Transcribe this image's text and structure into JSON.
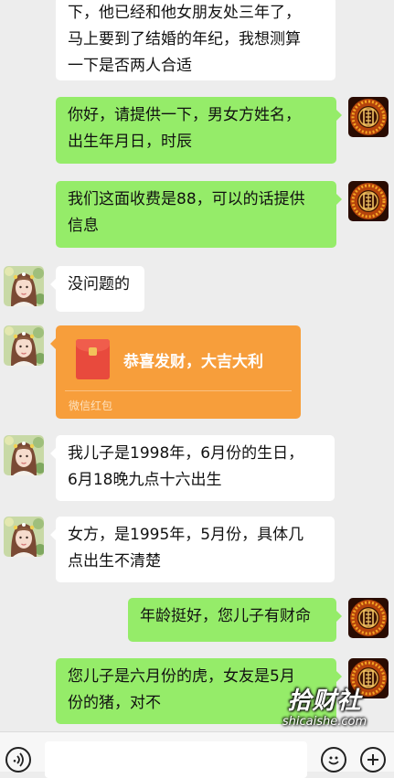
{
  "messages": [
    {
      "side": "in",
      "lines": [
        "下，他已经和他女朋友处三年了，",
        "马上要到了结婚的年纪，我想测算",
        "一下是否两人合适"
      ]
    },
    {
      "side": "out",
      "lines": [
        "你好，请提供一下，男女方姓名，",
        "出生年月日，时辰"
      ]
    },
    {
      "side": "out",
      "lines": [
        "我们这面收费是88，可以的话提供",
        "信息"
      ]
    },
    {
      "side": "in",
      "lines": [
        "没问题的"
      ]
    },
    {
      "side": "in",
      "type": "red-packet",
      "title": "恭喜发财，大吉大利",
      "footer": "微信红包"
    },
    {
      "side": "in",
      "lines": [
        "我儿子是1998年，6月份的生日，",
        "6月18晚九点十六出生"
      ]
    },
    {
      "side": "in",
      "lines": [
        "女方，是1995年，5月份，具体几",
        "点出生不清楚"
      ]
    },
    {
      "side": "out",
      "lines": [
        "年龄挺好，您儿子有财命"
      ]
    },
    {
      "side": "out",
      "lines": [
        "您儿子是六月份的虎，女友是5月",
        "份的猪，对不"
      ]
    }
  ],
  "watermark": {
    "main": "拾财社",
    "sub": "shicaishe.com"
  },
  "colors": {
    "background": "#ededed",
    "bubble_in": "#ffffff",
    "bubble_out": "#95ec69",
    "red_packet": "#f79e3b"
  },
  "icons": {
    "voice": "voice-icon",
    "emoji": "emoji-icon",
    "plus": "plus-icon"
  }
}
